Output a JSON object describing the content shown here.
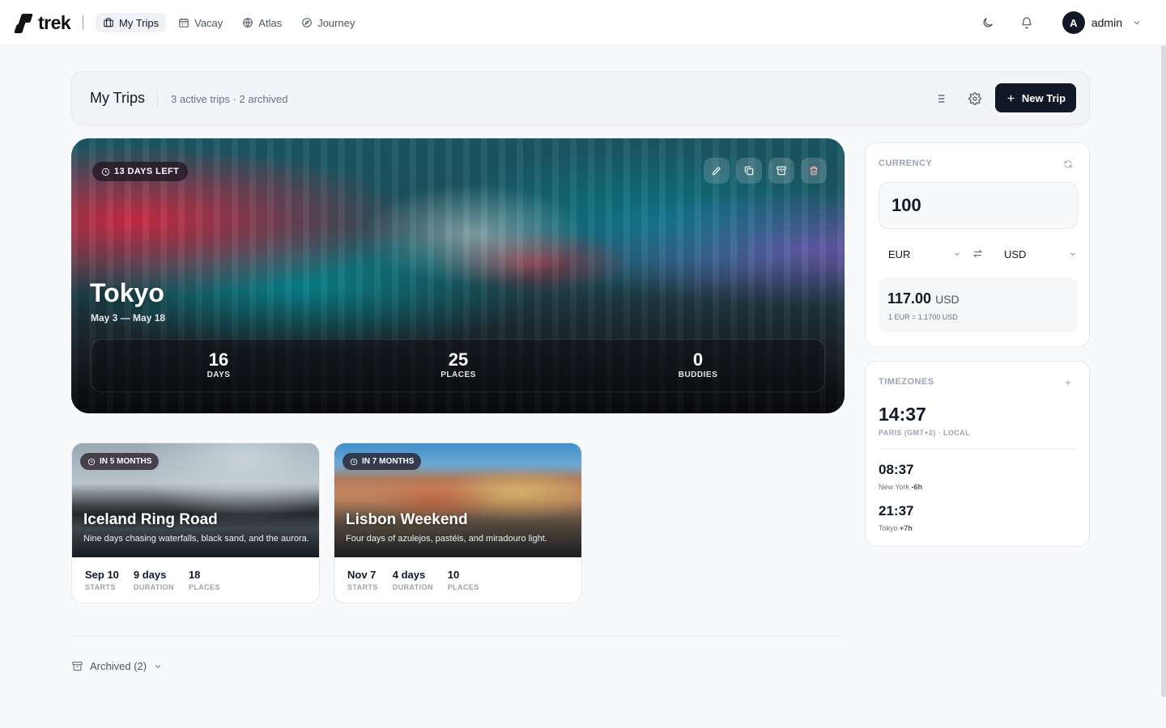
{
  "nav": {
    "logo_text": "trek",
    "items": [
      {
        "label": "My Trips",
        "icon": "suitcase-icon",
        "active": true
      },
      {
        "label": "Vacay",
        "icon": "calendar-icon"
      },
      {
        "label": "Atlas",
        "icon": "globe-icon"
      },
      {
        "label": "Journey",
        "icon": "compass-icon"
      }
    ],
    "user": {
      "initial": "A",
      "name": "admin"
    }
  },
  "header": {
    "title": "My Trips",
    "subtitle": "3 active trips · 2 archived",
    "new_trip_label": "New Trip"
  },
  "featured_trip": {
    "badge": "13 DAYS LEFT",
    "title": "Tokyo",
    "dates": "May 3 — May 18",
    "stats": [
      {
        "value": "16",
        "label": "DAYS"
      },
      {
        "value": "25",
        "label": "PLACES"
      },
      {
        "value": "0",
        "label": "BUDDIES"
      }
    ]
  },
  "trips": [
    {
      "badge": "IN 5 MONTHS",
      "title": "Iceland Ring Road",
      "description": "Nine days chasing waterfalls, black sand, and the aurora.",
      "stats": [
        {
          "value": "Sep 10",
          "label": "STARTS"
        },
        {
          "value": "9 days",
          "label": "DURATION"
        },
        {
          "value": "18",
          "label": "PLACES"
        }
      ]
    },
    {
      "badge": "IN 7 MONTHS",
      "title": "Lisbon Weekend",
      "description": "Four days of azulejos, pastéis, and miradouro light.",
      "stats": [
        {
          "value": "Nov 7",
          "label": "STARTS"
        },
        {
          "value": "4 days",
          "label": "DURATION"
        },
        {
          "value": "10",
          "label": "PLACES"
        }
      ]
    }
  ],
  "archived_label": "Archived (2)",
  "currency": {
    "label": "CURRENCY",
    "amount": "100",
    "from": "EUR",
    "to": "USD",
    "result_value": "117.00",
    "result_unit": "USD",
    "rate": "1 EUR = 1.1700 USD"
  },
  "timezones": {
    "label": "TIMEZONES",
    "local_time": "14:37",
    "local_label": "PARIS (GMT+2) · LOCAL",
    "others": [
      {
        "time": "08:37",
        "city": "New York",
        "offset": "-6h"
      },
      {
        "time": "21:37",
        "city": "Tokyo",
        "offset": "+7h"
      }
    ]
  },
  "colors": {
    "primary": "#111827",
    "background": "#f8f9fb",
    "muted": "#9ca3af"
  }
}
